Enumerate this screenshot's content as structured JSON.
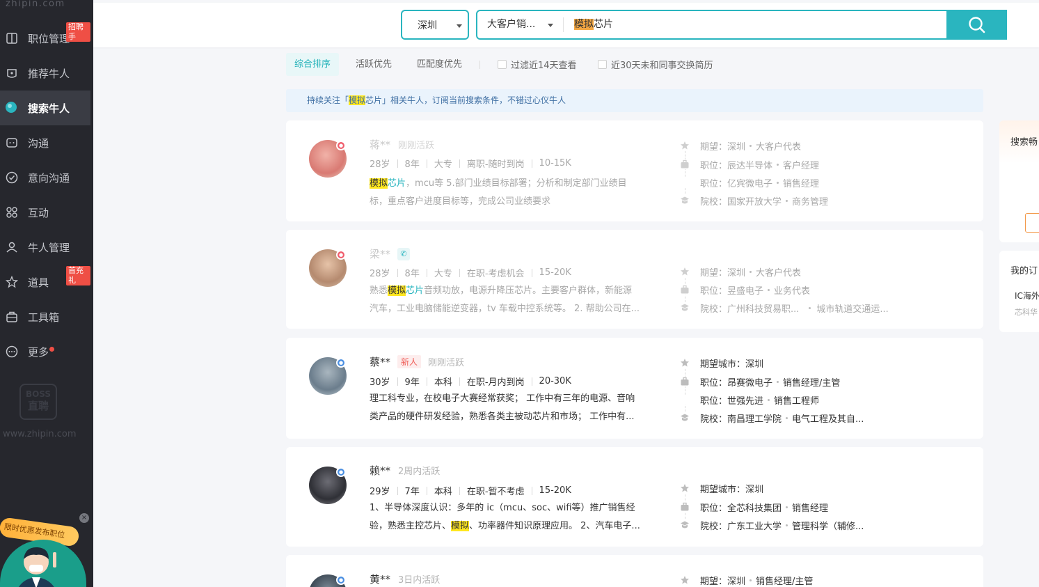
{
  "sidebar": {
    "domain": "zhipin.com",
    "items": [
      {
        "label": "职位管理",
        "icon": "job-management-icon",
        "badge": "招聘手"
      },
      {
        "label": "推荐牛人",
        "icon": "recommend-icon"
      },
      {
        "label": "搜索牛人",
        "icon": "search-talent-icon",
        "active": true
      },
      {
        "label": "沟通",
        "icon": "chat-icon"
      },
      {
        "label": "意向沟通",
        "icon": "intent-chat-icon"
      },
      {
        "label": "互动",
        "icon": "interaction-icon"
      },
      {
        "label": "牛人管理",
        "icon": "talent-management-icon"
      },
      {
        "label": "道具",
        "icon": "props-icon",
        "badge": "首充礼"
      },
      {
        "label": "工具箱",
        "icon": "toolbox-icon"
      },
      {
        "label": "更多",
        "icon": "more-icon",
        "dot": true
      }
    ],
    "logo_text": [
      "BOSS",
      "直聘"
    ],
    "url": "www.zhipin.com",
    "promo": {
      "text": "限时优惠发布职位",
      "close": "×"
    }
  },
  "search": {
    "city": "深圳",
    "position": "大客户销...",
    "query_highlight": "模拟",
    "query_rest": "芯片"
  },
  "filters": {
    "sort_options": [
      "综合排序",
      "活跃优先",
      "匹配度优先"
    ],
    "checks": [
      "过滤近14天查看",
      "近30天未和同事交换简历"
    ]
  },
  "notice": {
    "prefix": "持续关注「",
    "kw": "模拟",
    "rest": "芯片」相关牛人，订阅当前搜索条件，不错过心仪牛人"
  },
  "candidates": [
    {
      "name": "蒋**",
      "active": "刚刚活跃",
      "gender": "female",
      "meta": [
        "28岁",
        "8年",
        "大专",
        "离职-随时到岗",
        "10-15K"
      ],
      "desc_kw": "模拟",
      "desc_kw2": "芯片",
      "desc_rest": "，mcu等 5.部门业绩目标部署；分析和制定部门业绩目",
      "desc_line2": "标，重点客户进度目标等，完成公司业绩要求",
      "expect": {
        "label": "期望：",
        "a": "深圳",
        "b": "大客户代表"
      },
      "jobs": [
        {
          "label": "职位：",
          "a": "辰达半导体",
          "b": "客户经理"
        },
        {
          "label": "职位：",
          "a": "亿宾微电子",
          "b": "销售经理"
        }
      ],
      "school": {
        "label": "院校：",
        "a": "国家开放大学",
        "b": "商务管理"
      }
    },
    {
      "name": "梁**",
      "active": "",
      "gender": "female",
      "phone": "✆",
      "meta": [
        "28岁",
        "8年",
        "大专",
        "在职-考虑机会",
        "15-20K"
      ],
      "desc_pre": "熟悉",
      "desc_kw": "模拟",
      "desc_kw2": "芯片",
      "desc_rest": "音频功放，电源升降压芯片。主要客户群体，新能源",
      "desc_line2": "汽车，工业电脑储能逆变器，tv 车载中控系统等。 2. 帮助公司在...",
      "expect": {
        "label": "期望：",
        "a": "深圳",
        "b": "大客户代表"
      },
      "jobs": [
        {
          "label": "职位：",
          "a": "昱盛电子",
          "b": "业务代表"
        }
      ],
      "school": {
        "label": "院校：",
        "a": "广州科技贸易职...",
        "b": "城市轨道交通运..."
      }
    },
    {
      "name": "蔡**",
      "new_tag": "新人",
      "active": "刚刚活跃",
      "gender": "male",
      "meta": [
        "30岁",
        "9年",
        "本科",
        "在职-月内到岗",
        "20-30K"
      ],
      "desc_line1": "理工科专业，在校电子大赛经常获奖； 工作中有三年的电源、音响",
      "desc_line2": "类产品的硬件研发经验，熟悉各类主被动芯片和市场； 工作中有...",
      "expect": {
        "label": "期望城市：",
        "a": "深圳",
        "b": ""
      },
      "jobs": [
        {
          "label": "职位：",
          "a": "昂赛微电子",
          "b": "销售经理/主管"
        },
        {
          "label": "职位：",
          "a": "世强先进",
          "b": "销售工程师"
        }
      ],
      "school": {
        "label": "院校：",
        "a": "南昌理工学院",
        "b": "电气工程及其自..."
      }
    },
    {
      "name": "赖**",
      "active": "2周内活跃",
      "gender": "male",
      "meta": [
        "29岁",
        "7年",
        "本科",
        "在职-暂不考虑",
        "15-20K"
      ],
      "desc_line1": "1、半导体深度认识：多年的 ic（mcu、soc、wifi等）推广销售经",
      "desc_pre2": "验，熟悉主控芯片、",
      "desc_kw": "模拟",
      "desc_rest2": "、功率器件知识原理应用。 2、汽车电子...",
      "expect": {
        "label": "期望城市：",
        "a": "深圳",
        "b": ""
      },
      "jobs": [
        {
          "label": "职位：",
          "a": "全芯科技集团",
          "b": "销售经理"
        }
      ],
      "school": {
        "label": "院校：",
        "a": "广东工业大学",
        "b": "管理科学（辅修..."
      }
    },
    {
      "name": "黄**",
      "active": "3日内活跃",
      "gender": "male",
      "expect": {
        "label": "期望：",
        "a": "深圳",
        "b": "销售经理/主管"
      }
    }
  ],
  "right_panel": {
    "title1": "搜索畅",
    "title2": "我的订",
    "sub1": "IC海外",
    "sub2": "芯科华"
  },
  "colors": {
    "accent": "#2ab5bf",
    "sidebar_bg": "#26272d",
    "highlight": "#ffe71f",
    "badge": "#ef4f45"
  }
}
